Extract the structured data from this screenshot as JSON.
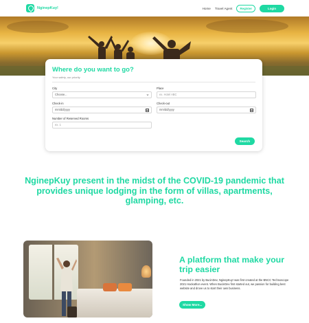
{
  "colors": {
    "accent": "#1fd9a3"
  },
  "nav": {
    "brand": "NginepKuy!",
    "links": [
      "Home",
      "Travel Agent"
    ],
    "register": "Register",
    "login": "Login"
  },
  "search": {
    "title": "Where do you want to go?",
    "subtitle": "Your safety, our priority",
    "city_label": "City",
    "city_value": "Choose...",
    "place_label": "Place",
    "place_placeholder": "ex. Hotel ABC",
    "checkin_label": "Check-in",
    "checkin_value": "mm/dd/yyyy",
    "checkout_label": "Check-out",
    "checkout_value": "mm/dd/yyyy",
    "rooms_label": "Number of Reserved Rooms",
    "rooms_placeholder": "ex. 1",
    "button": "Search"
  },
  "mission": "NginepKuy present in the midst of the COVID-19 pandemic that provides unique lodging in the form of villas, apartments, glamping, etc.",
  "platform": {
    "title": "A platform that make your trip easier",
    "text": "Founded in 2021 by BucinDev, NginepKuy! was first created at the BNCC Technoscope 2021 Hackathon event. When BucinDev first started out, we passion for building best website and drove us to start their own business.",
    "button": "Show More..."
  }
}
